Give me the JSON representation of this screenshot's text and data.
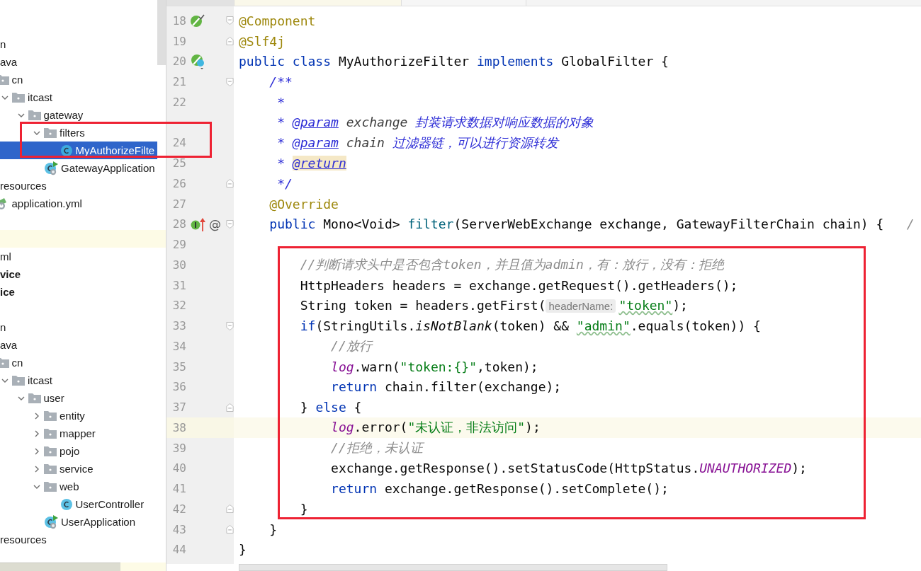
{
  "project_tree": [
    {
      "label": "n",
      "selected": false,
      "children": [
        {
          "label": "ava",
          "selected": false,
          "children": [
            {
              "label": "cn",
              "kind": "folder",
              "selected": false,
              "children": [
                {
                  "label": "itcast",
                  "kind": "folder",
                  "expanded": true,
                  "selected": false,
                  "children": [
                    {
                      "label": "gateway",
                      "kind": "folder",
                      "expanded": true,
                      "selected": false,
                      "children": [
                        {
                          "label": "filters",
                          "kind": "folder",
                          "expanded": true,
                          "selected": false,
                          "children": [
                            {
                              "label": "MyAuthorizeFilte",
                              "kind": "class",
                              "selected": true
                            }
                          ]
                        },
                        {
                          "label": "GatewayApplication",
                          "kind": "app",
                          "selected": false
                        }
                      ]
                    }
                  ]
                }
              ]
            }
          ]
        },
        {
          "label": "resources",
          "selected": false,
          "children": [
            {
              "label": "application.yml",
              "kind": "yml",
              "selected": false
            }
          ]
        }
      ]
    },
    {
      "label": "ml",
      "selected": false
    },
    {
      "label": "vice",
      "kind": "module",
      "selected": false
    },
    {
      "label": "ice",
      "kind": "module",
      "selected": false
    },
    {
      "label": "n",
      "selected": false,
      "children": [
        {
          "label": "ava",
          "selected": false,
          "children": [
            {
              "label": "cn",
              "kind": "folder",
              "selected": false,
              "children": [
                {
                  "label": "itcast",
                  "kind": "folder",
                  "expanded": true,
                  "selected": false,
                  "children": [
                    {
                      "label": "user",
                      "kind": "folder",
                      "expanded": true,
                      "selected": false,
                      "children": [
                        {
                          "label": "entity",
                          "kind": "folder",
                          "expanded": false,
                          "selected": false
                        },
                        {
                          "label": "mapper",
                          "kind": "folder",
                          "expanded": false,
                          "selected": false
                        },
                        {
                          "label": "pojo",
                          "kind": "folder",
                          "expanded": false,
                          "selected": false
                        },
                        {
                          "label": "service",
                          "kind": "folder",
                          "expanded": false,
                          "selected": false
                        },
                        {
                          "label": "web",
                          "kind": "folder",
                          "expanded": true,
                          "selected": false,
                          "children": [
                            {
                              "label": "UserController",
                              "kind": "class",
                              "selected": false
                            }
                          ]
                        },
                        {
                          "label": "UserApplication",
                          "kind": "app",
                          "selected": false
                        }
                      ]
                    }
                  ]
                }
              ]
            }
          ]
        },
        {
          "label": "resources",
          "selected": false
        }
      ]
    }
  ],
  "editor": {
    "lines": [
      {
        "number": "18",
        "current": false,
        "fold_marker": {
          "kind": "start"
        },
        "gutter_icon": {
          "kind": "bean_check"
        },
        "tokens": [
          {
            "kind": "ann",
            "text": "@Component"
          }
        ]
      },
      {
        "number": "19",
        "current": false,
        "fold_marker": {
          "kind": "end"
        },
        "tokens": [
          {
            "kind": "ann",
            "text": "@Slf4j"
          }
        ]
      },
      {
        "number": "20",
        "current": false,
        "gutter_icon": {
          "kind": "bean_class"
        },
        "tokens": [
          {
            "kind": "kw",
            "text": "public class "
          },
          {
            "kind": "p",
            "text": "MyAuthorizeFilter "
          },
          {
            "kind": "kw",
            "text": "implements "
          },
          {
            "kind": "p",
            "text": "GlobalFilter {"
          }
        ]
      },
      {
        "number": "21",
        "current": false,
        "fold_marker": {
          "kind": "start"
        },
        "tokens": [
          {
            "kind": "doc",
            "text": "    /**"
          }
        ]
      },
      {
        "number": "22",
        "current": false,
        "tokens": [
          {
            "kind": "doc",
            "text": "     *"
          }
        ]
      },
      {
        "current": false,
        "tokens": [
          {
            "kind": "doc",
            "text": "     * "
          },
          {
            "kind": "tag",
            "text": "@param"
          },
          {
            "kind": "docname",
            "text": " exchange "
          },
          {
            "kind": "doc",
            "text": "封装请求数据对响应数据的对象"
          }
        ]
      },
      {
        "number": "24",
        "current": false,
        "tokens": [
          {
            "kind": "doc",
            "text": "     * "
          },
          {
            "kind": "tag",
            "text": "@param"
          },
          {
            "kind": "docname",
            "text": " chain "
          },
          {
            "kind": "doc",
            "text": "过滤器链，可以进行资源转发"
          }
        ]
      },
      {
        "number": "25",
        "current": false,
        "tokens": [
          {
            "kind": "doc",
            "text": "     * "
          },
          {
            "kind": "tag_hl",
            "text": "@return"
          }
        ]
      },
      {
        "number": "26",
        "current": false,
        "fold_marker": {
          "kind": "end"
        },
        "tokens": [
          {
            "kind": "doc",
            "text": "     */"
          }
        ]
      },
      {
        "number": "27",
        "current": false,
        "tokens": [
          {
            "kind": "ann",
            "text": "    @Override"
          }
        ]
      },
      {
        "number": "28",
        "current": false,
        "fold_marker": {
          "kind": "start"
        },
        "gutter_icon": {
          "kind": "implements"
        },
        "gutter_text": "@",
        "tokens": [
          {
            "kind": "kw",
            "text": "    public "
          },
          {
            "kind": "p",
            "text": "Mono<Void> "
          },
          {
            "kind": "decl",
            "text": "filter"
          },
          {
            "kind": "p",
            "text": "(ServerWebExchange exchange, GatewayFilterChain chain) {   "
          },
          {
            "kind": "comment",
            "text": "/"
          }
        ]
      },
      {
        "number": "29",
        "current": false
      },
      {
        "number": "30",
        "current": false,
        "tokens": [
          {
            "kind": "comment",
            "text": "        //判断请求头中是否包含token，并且值为admin，有：放行，没有：拒绝"
          }
        ]
      },
      {
        "number": "31",
        "current": false,
        "tokens": [
          {
            "kind": "p",
            "text": "        HttpHeaders headers = exchange.getRequest().getHeaders();"
          }
        ]
      },
      {
        "number": "32",
        "current": false,
        "tokens": [
          {
            "kind": "p",
            "text": "        String token = headers.getFirst("
          },
          {
            "kind": "hint",
            "text": "headerName:"
          },
          {
            "kind": "str_typo",
            "text": "\"token\""
          },
          {
            "kind": "p",
            "text": ");"
          }
        ]
      },
      {
        "number": "33",
        "current": false,
        "fold_marker": {
          "kind": "start"
        },
        "tokens": [
          {
            "kind": "kw",
            "text": "        if"
          },
          {
            "kind": "p",
            "text": "(StringUtils."
          },
          {
            "kind": "static",
            "text": "isNotBlank"
          },
          {
            "kind": "p",
            "text": "(token) && "
          },
          {
            "kind": "str_typo",
            "text": "\"admin\""
          },
          {
            "kind": "p",
            "text": ".equals(token)) {"
          }
        ]
      },
      {
        "number": "34",
        "current": false,
        "tokens": [
          {
            "kind": "comment",
            "text": "            //放行"
          }
        ]
      },
      {
        "number": "35",
        "current": false,
        "tokens": [
          {
            "kind": "field",
            "text": "            log"
          },
          {
            "kind": "p",
            "text": ".warn("
          },
          {
            "kind": "str",
            "text": "\"token:{}\""
          },
          {
            "kind": "p",
            "text": ",token);"
          }
        ]
      },
      {
        "number": "36",
        "current": false,
        "tokens": [
          {
            "kind": "kw",
            "text": "            return "
          },
          {
            "kind": "p",
            "text": "chain.filter(exchange);"
          }
        ]
      },
      {
        "number": "37",
        "current": false,
        "fold_marker": {
          "kind": "end"
        },
        "tokens": [
          {
            "kind": "p",
            "text": "        } "
          },
          {
            "kind": "kw",
            "text": "else"
          },
          {
            "kind": "p",
            "text": " {"
          }
        ]
      },
      {
        "number": "38",
        "current": true,
        "tokens": [
          {
            "kind": "field",
            "text": "            log"
          },
          {
            "kind": "p",
            "text": ".error("
          },
          {
            "kind": "str",
            "text": "\"未认证，非法访问\""
          },
          {
            "kind": "p",
            "text": ");"
          }
        ]
      },
      {
        "number": "39",
        "current": false,
        "tokens": [
          {
            "kind": "comment",
            "text": "            //拒绝，未认证"
          }
        ]
      },
      {
        "number": "40",
        "current": false,
        "tokens": [
          {
            "kind": "p",
            "text": "            exchange.getResponse().setStatusCode(HttpStatus."
          },
          {
            "kind": "field",
            "text": "UNAUTHORIZED"
          },
          {
            "kind": "p",
            "text": ");"
          }
        ]
      },
      {
        "number": "41",
        "current": false,
        "tokens": [
          {
            "kind": "kw",
            "text": "            return "
          },
          {
            "kind": "p",
            "text": "exchange.getResponse().setComplete();"
          }
        ]
      },
      {
        "number": "42",
        "current": false,
        "fold_marker": {
          "kind": "end"
        },
        "tokens": [
          {
            "kind": "p",
            "text": "        }"
          }
        ]
      },
      {
        "number": "43",
        "current": false,
        "fold_marker": {
          "kind": "end"
        },
        "tokens": [
          {
            "kind": "p",
            "text": "    }"
          }
        ]
      },
      {
        "number": "44",
        "current": false,
        "tokens": [
          {
            "kind": "p",
            "text": "}"
          }
        ]
      }
    ]
  }
}
